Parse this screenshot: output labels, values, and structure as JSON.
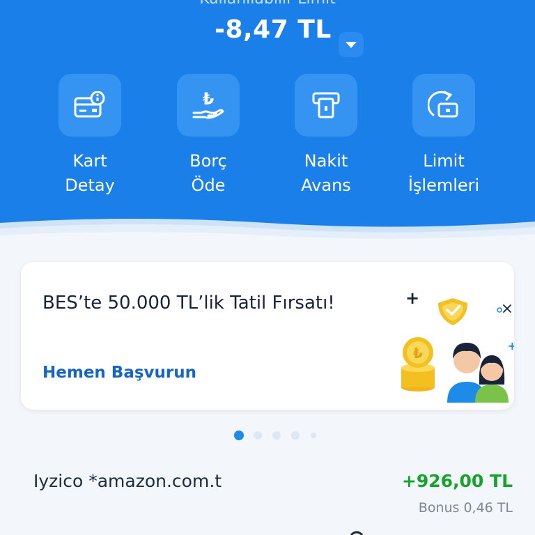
{
  "header": {
    "limit_label": "Kullanılabilir Limit",
    "limit_value": "-8,47 TL"
  },
  "actions": [
    {
      "line1": "Kart",
      "line2": "Detay",
      "icon": "card-info-icon"
    },
    {
      "line1": "Borç",
      "line2": "Öde",
      "icon": "lira-hand-icon"
    },
    {
      "line1": "Nakit",
      "line2": "Avans",
      "icon": "atm-icon"
    },
    {
      "line1": "Limit",
      "line2": "İşlemleri",
      "icon": "card-refresh-icon"
    }
  ],
  "promo": {
    "title": "BES’te 50.000 TL’lik Tatil Fırsatı!",
    "cta": "Hemen Başvurun",
    "illustration": "family-coins-shield-illustration"
  },
  "carousel": {
    "total": 5,
    "active": 0
  },
  "transaction": {
    "merchant": "Iyzico *amazon.com.t",
    "amount": "+926,00 TL",
    "bonus": "Bonus 0,46 TL"
  },
  "colors": {
    "header_bg": "#1a7fe8",
    "tile_bg": "#3594f2",
    "link": "#1565c4",
    "positive": "#15a32a"
  }
}
